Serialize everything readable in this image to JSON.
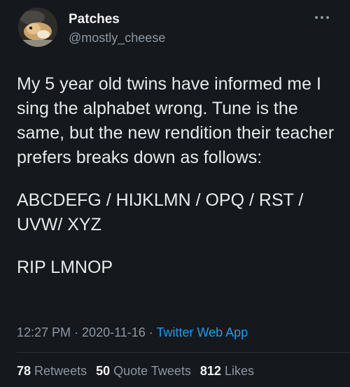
{
  "author": {
    "display_name": "Patches",
    "handle": "@mostly_cheese",
    "avatar_icon": "hamster-avatar",
    "more_icon": "more-options-icon"
  },
  "tweet": {
    "paragraphs": [
      "My 5 year old twins have informed me I sing the alphabet wrong. Tune is the same, but the new rendition their teacher prefers breaks down as follows:",
      "ABCDEFG / HIJKLMN / OPQ / RST / UVW/ XYZ",
      "RIP LMNOP"
    ]
  },
  "meta": {
    "time": "12:27 PM",
    "separator": " · ",
    "date": "2020-11-16",
    "app": "Twitter Web App"
  },
  "stats": {
    "retweets_count": "78",
    "retweets_label": "Retweets",
    "quotes_count": "50",
    "quotes_label": "Quote Tweets",
    "likes_count": "812",
    "likes_label": "Likes"
  },
  "colors": {
    "background": "#15181c",
    "text": "#e7e9ea",
    "secondary": "#8b98a5",
    "link": "#1d9bf0"
  }
}
